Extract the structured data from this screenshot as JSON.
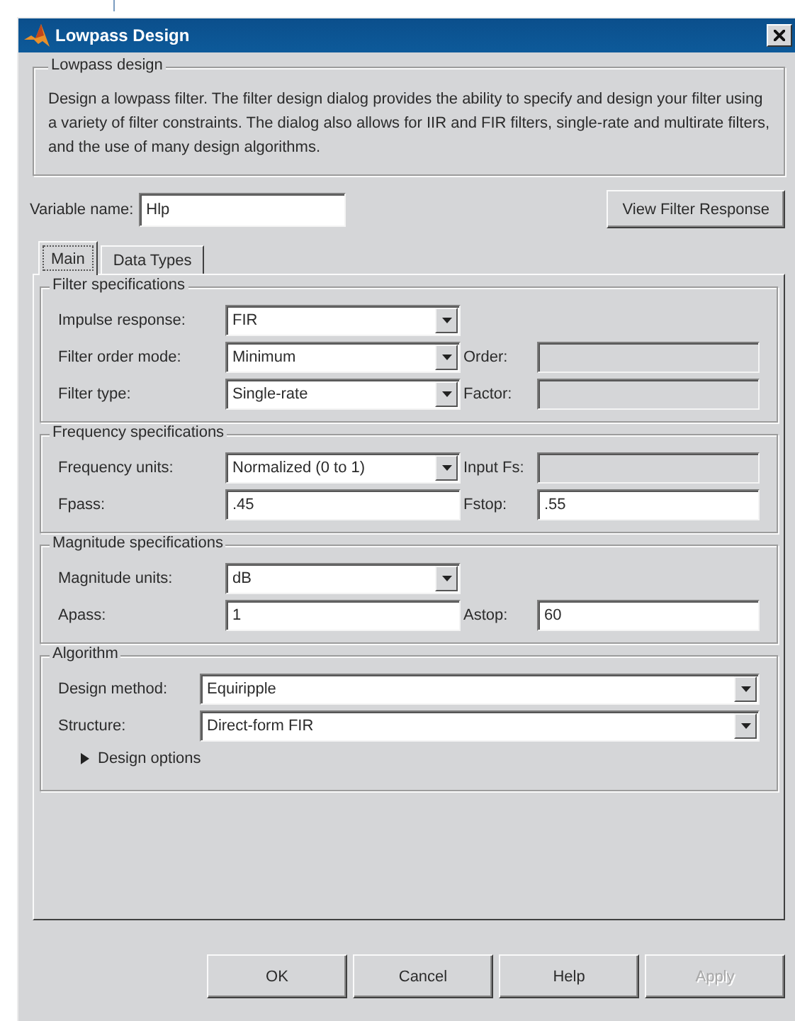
{
  "window": {
    "title": "Lowpass Design"
  },
  "description_group": {
    "title": "Lowpass design",
    "text": "Design a lowpass filter.  The filter design dialog provides the ability to specify and design your filter using a variety of filter constraints.  The dialog also allows for IIR and FIR filters, single-rate and multirate filters, and the use of many design algorithms."
  },
  "variable_name": {
    "label": "Variable name:",
    "value": "Hlp"
  },
  "view_button": {
    "label": "View Filter Response"
  },
  "tabs": [
    {
      "label": "Main",
      "selected": true
    },
    {
      "label": "Data Types",
      "selected": false
    }
  ],
  "groups": [
    {
      "title": "Filter specifications",
      "kind": "paired",
      "rows": [
        {
          "fields": [
            {
              "label": "Impulse response:",
              "kind": "dropdown",
              "value": "FIR",
              "disabled": false
            }
          ]
        },
        {
          "fields": [
            {
              "label": "Filter order mode:",
              "kind": "dropdown",
              "value": "Minimum",
              "disabled": false
            },
            {
              "label": "Order:",
              "kind": "text",
              "disabled": true
            }
          ]
        },
        {
          "fields": [
            {
              "label": "Filter type:",
              "kind": "dropdown",
              "value": "Single-rate",
              "disabled": false
            },
            {
              "label": "Factor:",
              "kind": "text",
              "disabled": true
            }
          ]
        }
      ]
    },
    {
      "title": "Frequency specifications",
      "kind": "paired",
      "rows": [
        {
          "fields": [
            {
              "label": "Frequency units:",
              "kind": "dropdown",
              "value": "Normalized (0 to 1)",
              "disabled": false
            },
            {
              "label": "Input Fs:",
              "kind": "text",
              "disabled": true
            }
          ]
        },
        {
          "fields": [
            {
              "label": "Fpass:",
              "kind": "text",
              "value": ".45",
              "disabled": false
            },
            {
              "label": "Fstop:",
              "kind": "text",
              "value": ".55",
              "disabled": false
            }
          ]
        }
      ]
    },
    {
      "title": "Magnitude specifications",
      "kind": "paired",
      "rows": [
        {
          "fields": [
            {
              "label": "Magnitude units:",
              "kind": "dropdown",
              "value": "dB",
              "disabled": false
            }
          ]
        },
        {
          "fields": [
            {
              "label": "Apass:",
              "kind": "text",
              "value": "1",
              "disabled": false
            },
            {
              "label": "Astop:",
              "kind": "text",
              "value": "60",
              "disabled": false
            }
          ]
        }
      ]
    },
    {
      "title": "Algorithm",
      "kind": "full",
      "rows": [
        {
          "fields": [
            {
              "label": "Design method:",
              "kind": "dropdown",
              "value": "Equiripple",
              "disabled": false
            }
          ]
        },
        {
          "fields": [
            {
              "label": "Structure:",
              "kind": "dropdown",
              "value": "Direct-form FIR",
              "disabled": false
            }
          ]
        }
      ],
      "expander": {
        "label": "Design options",
        "expanded": false
      }
    }
  ],
  "buttons": [
    {
      "label": "OK",
      "disabled": false
    },
    {
      "label": "Cancel",
      "disabled": false
    },
    {
      "label": "Help",
      "disabled": false
    },
    {
      "label": "Apply",
      "disabled": true
    }
  ]
}
